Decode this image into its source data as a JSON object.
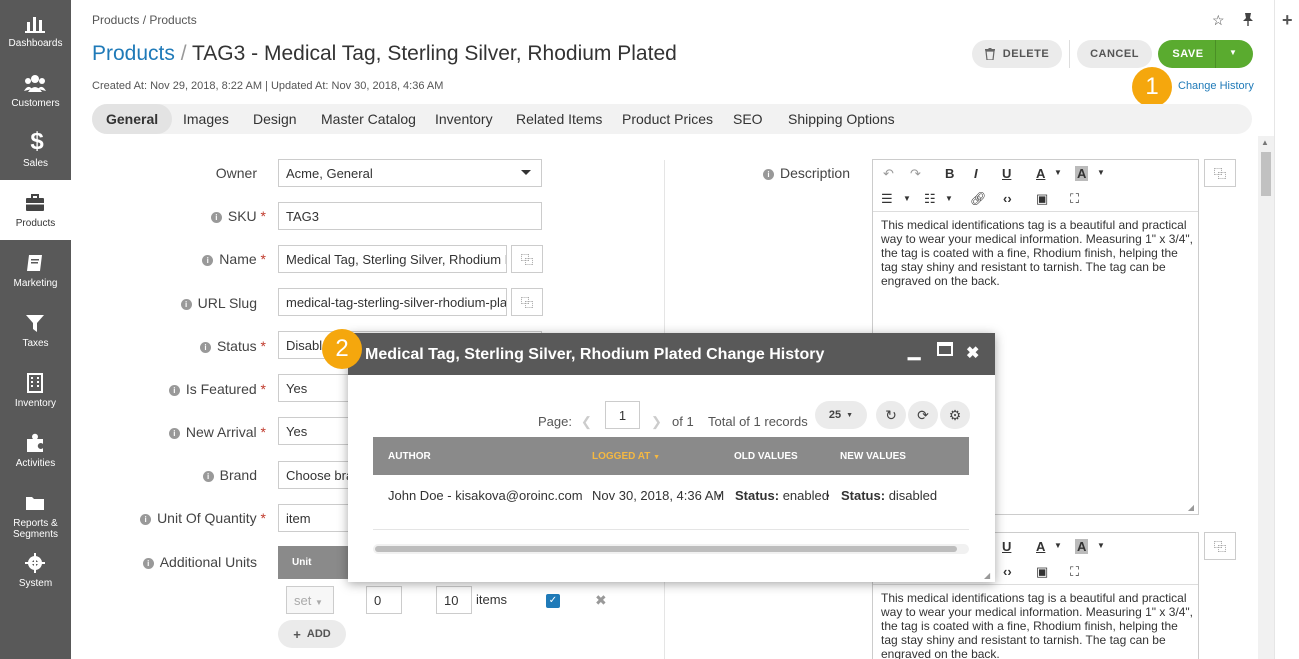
{
  "sidebar": {
    "items": [
      {
        "label": "Dashboards"
      },
      {
        "label": "Customers"
      },
      {
        "label": "Sales"
      },
      {
        "label": "Products"
      },
      {
        "label": "Marketing"
      },
      {
        "label": "Taxes"
      },
      {
        "label": "Inventory"
      },
      {
        "label": "Activities"
      },
      {
        "label": "Reports &"
      },
      {
        "label": "Segments"
      },
      {
        "label": "System"
      }
    ]
  },
  "header": {
    "breadcrumb": "Products / Products",
    "title_crumb": "Products",
    "title_sep": "/",
    "title": "TAG3 - Medical Tag, Sterling Silver, Rhodium Plated",
    "meta": "Created At: Nov 29, 2018, 8:22 AM  |  Updated At: Nov 30, 2018, 4:36 AM",
    "delete_label": "DELETE",
    "cancel_label": "CANCEL",
    "save_label": "SAVE",
    "change_history_label": "Change History"
  },
  "callouts": {
    "one": "1",
    "two": "2"
  },
  "tabs": [
    "General",
    "Images",
    "Design",
    "Master Catalog",
    "Inventory",
    "Related Items",
    "Product Prices",
    "SEO",
    "Shipping Options"
  ],
  "form": {
    "owner_label": "Owner",
    "owner_value": "Acme, General",
    "sku_label": "SKU",
    "sku_value": "TAG3",
    "name_label": "Name",
    "name_value": "Medical Tag, Sterling Silver, Rhodium Pla",
    "slug_label": "URL Slug",
    "slug_value": "medical-tag-sterling-silver-rhodium-pla",
    "status_label": "Status",
    "status_value": "Disable",
    "featured_label": "Is Featured",
    "featured_value": "Yes",
    "arrival_label": "New Arrival",
    "arrival_value": "Yes",
    "brand_label": "Brand",
    "brand_value": "Choose bra",
    "uoq_label": "Unit Of Quantity",
    "uoq_value": "item",
    "units_label": "Additional Units",
    "units_header": "Unit",
    "unit_select": "set",
    "unit_precision": "0",
    "unit_rate": "10",
    "unit_rate_suffix": "items",
    "add_label": "ADD",
    "required_mark": "*"
  },
  "description": {
    "label": "Description",
    "text": "This medical identifications tag is a beautiful and practical way to wear your medical information. Measuring 1\" x 3/4\", the tag is coated with a fine, Rhodium finish, helping the tag stay shiny and resistant to tarnish. The tag can be engraved on the back.",
    "text2": "This medical identifications tag is a beautiful and practical way to wear your medical information. Measuring 1\" x 3/4\", the tag is coated with a fine, Rhodium finish, helping the tag stay shiny and resistant to tarnish. The tag can be engraved on the back."
  },
  "modal": {
    "title": "Medical Tag, Sterling Silver, Rhodium Plated Change History",
    "page_label": "Page:",
    "page_value": "1",
    "of_label": "of 1",
    "total_label": "Total of 1 records",
    "per_page": "25",
    "columns": [
      "AUTHOR",
      "LOGGED AT",
      "OLD VALUES",
      "NEW VALUES"
    ],
    "row": {
      "author": "John Doe - kisakova@oroinc.com",
      "logged_at": "Nov 30, 2018, 4:36 AM",
      "old_key": "Status:",
      "old_value": "enabled",
      "new_key": "Status:",
      "new_value": "disabled"
    }
  },
  "colors": {
    "accent": "#1f7ab8",
    "save": "#5aab2f",
    "callout": "#f5a70d",
    "sidebar": "#595959"
  }
}
